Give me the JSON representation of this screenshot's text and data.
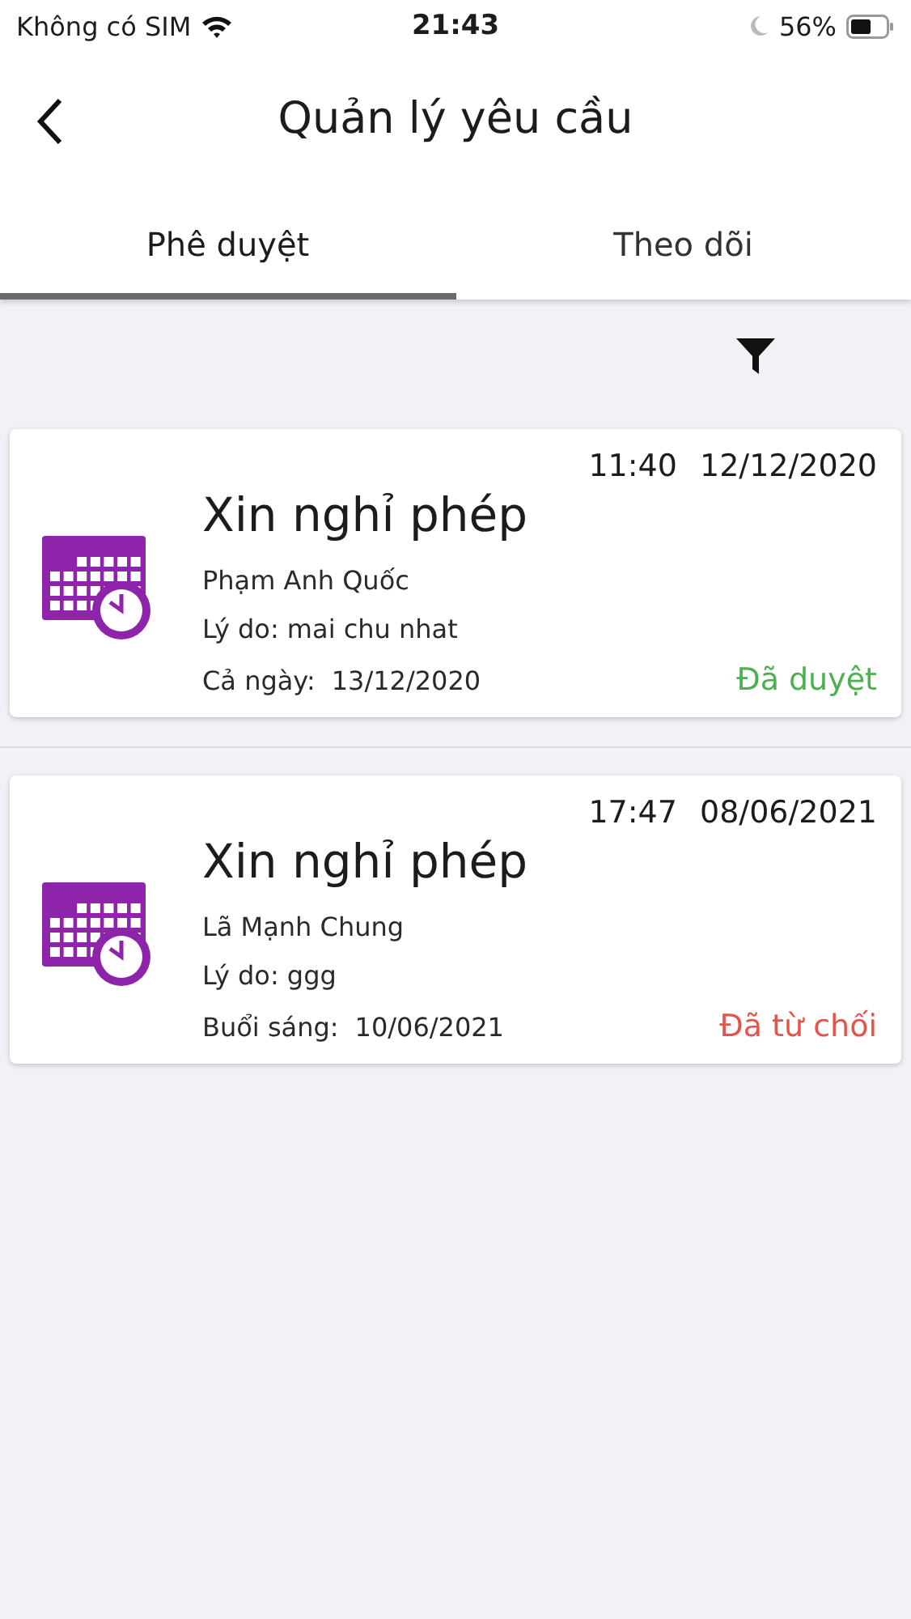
{
  "status_bar": {
    "carrier": "Không có SIM",
    "time": "21:43",
    "battery": "56%"
  },
  "header": {
    "title": "Quản lý yêu cầu"
  },
  "tabs": [
    {
      "label": "Phê duyệt",
      "selected": true
    },
    {
      "label": "Theo dõi",
      "selected": false
    }
  ],
  "requests": [
    {
      "time": "11:40",
      "date": "12/12/2020",
      "title": "Xin nghỉ phép",
      "person": "Phạm Anh Quốc",
      "reason": "Lý do: mai chu nhat",
      "period_label": "Cả ngày:",
      "period_date": "13/12/2020",
      "status": "Đã duyệt",
      "color": "#4caf50"
    },
    {
      "time": "17:47",
      "date": "08/06/2021",
      "title": "Xin nghỉ phép",
      "person": "Lã Mạnh Chung",
      "reason": "Lý do: ggg",
      "period_label": "Buổi sáng:",
      "period_date": "10/06/2021",
      "status": "Đã từ chối",
      "color": "#e5534b"
    }
  ]
}
